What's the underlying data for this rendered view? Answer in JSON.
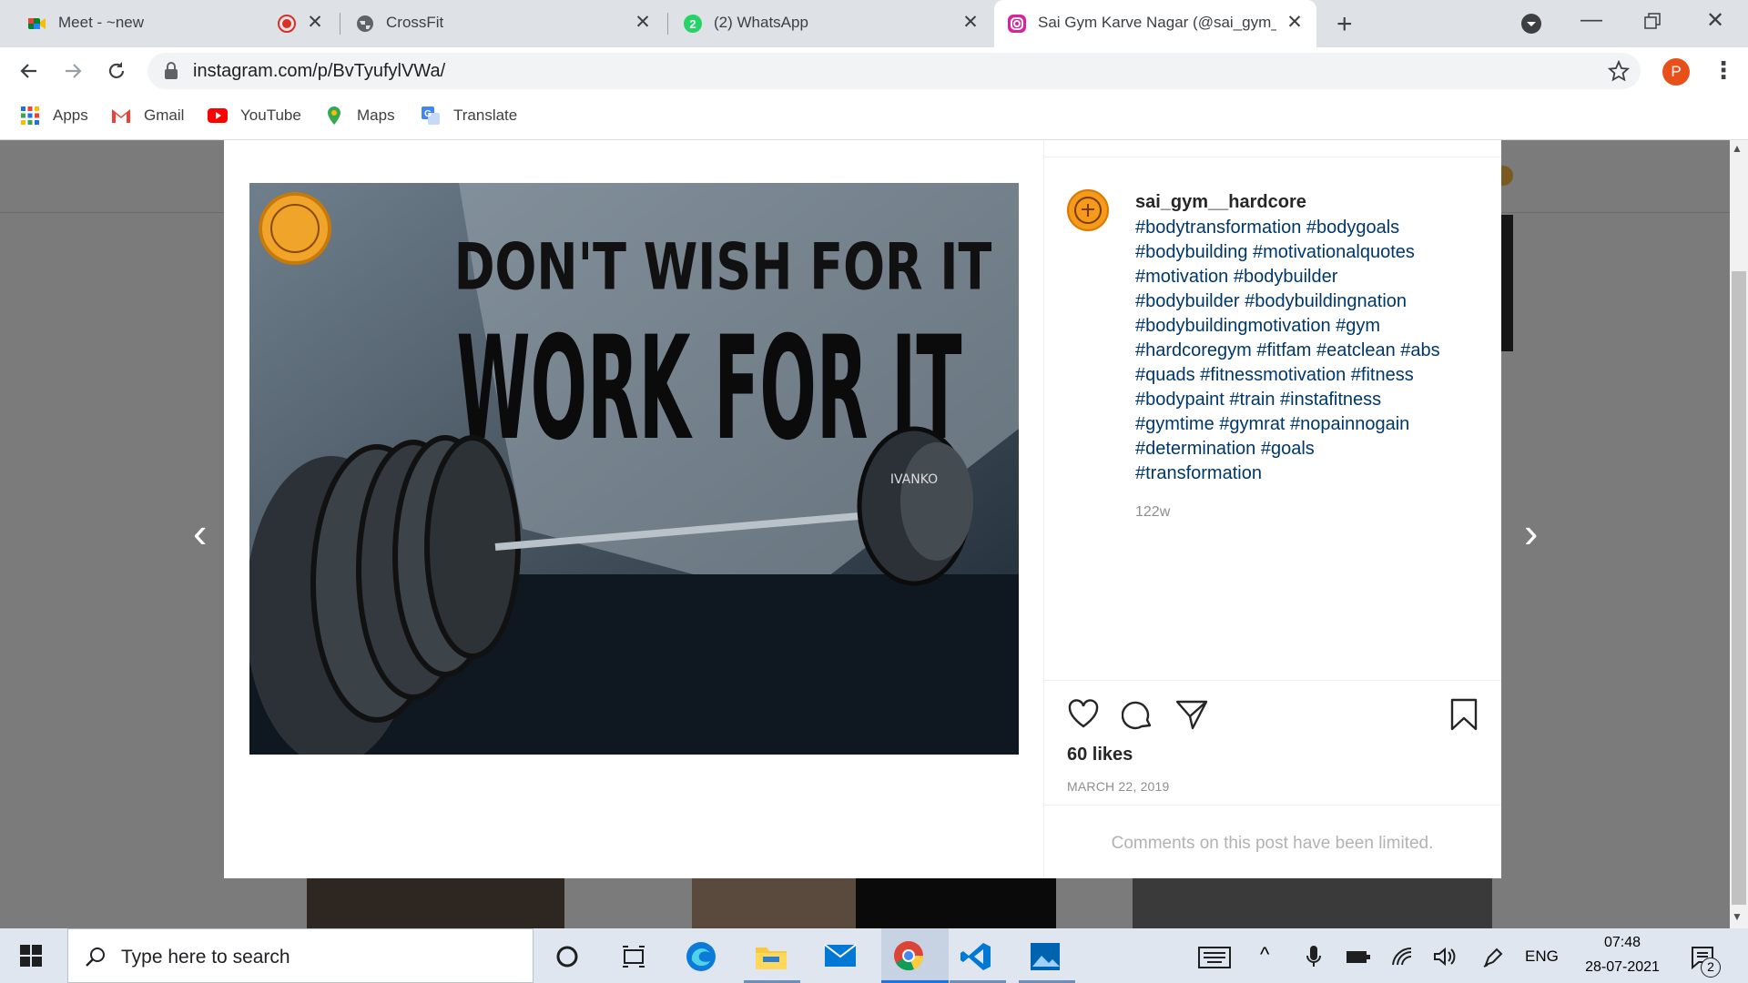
{
  "browser": {
    "tabs": [
      {
        "title": "Meet - ~new",
        "icon": "google-meet-icon"
      },
      {
        "title": "CrossFit",
        "icon": "globe-icon"
      },
      {
        "title": "(2) WhatsApp",
        "icon": "whatsapp-icon"
      },
      {
        "title": "Sai Gym Karve Nagar (@sai_gym_",
        "icon": "instagram-icon"
      }
    ],
    "url": "instagram.com/p/BvTyufylVWa/",
    "profile_initial": "P",
    "bookmarks": [
      {
        "label": "Apps",
        "icon": "apps-grid-icon"
      },
      {
        "label": "Gmail",
        "icon": "gmail-icon"
      },
      {
        "label": "YouTube",
        "icon": "youtube-icon"
      },
      {
        "label": "Maps",
        "icon": "maps-icon"
      },
      {
        "label": "Translate",
        "icon": "translate-icon"
      }
    ]
  },
  "post": {
    "username": "sai_gym__hardcore",
    "caption_lines": [
      "#bodytransformation #bodygoals",
      "#bodybuilding #motivationalquotes",
      "#motivation #bodybuilder",
      "#bodybuilder #bodybuildingnation",
      "#bodybuildingmotivation #gym",
      "#hardcoregym #fitfam #eatclean #abs",
      "#quads #fitnessmotivation #fitness",
      "#bodypaint #train #instafitness",
      "#gymtime #gymrat #nopainnogain",
      "#determination #goals",
      "#transformation"
    ],
    "age": "122w",
    "likes": "60 likes",
    "date": "MARCH 22, 2019",
    "comments_notice": "Comments on this post have been limited.",
    "image_text": {
      "line1": "DON'T WISH FOR IT",
      "line2": "WORK FOR IT",
      "plate_brand": "IVANKO"
    }
  },
  "taskbar": {
    "search_placeholder": "Type here to search",
    "language": "ENG",
    "time": "07:48",
    "date": "28-07-2021",
    "notification_count": "2"
  },
  "colors": {
    "link": "#00376b",
    "tab_bg": "#dee1e6",
    "overlay": "#7b7b7b",
    "profile": "#e8501a"
  }
}
